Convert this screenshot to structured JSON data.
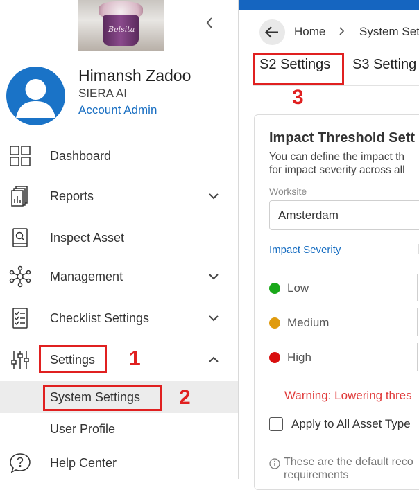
{
  "profile": {
    "name": "Himansh Zadoo",
    "organization": "SIERA AI",
    "role": "Account Admin",
    "photo_brand_text": "Belsita"
  },
  "nav": {
    "dashboard": "Dashboard",
    "reports": "Reports",
    "inspect_asset": "Inspect Asset",
    "management": "Management",
    "checklist_settings": "Checklist Settings",
    "settings": "Settings",
    "system_settings": "System Settings",
    "user_profile": "User Profile",
    "help_center": "Help Center"
  },
  "annotations": {
    "n1": "1",
    "n2": "2",
    "n3": "3"
  },
  "breadcrumb": {
    "home": "Home",
    "current": "System Set"
  },
  "tabs": {
    "s2": "S2 Settings",
    "s3": "S3 Setting"
  },
  "card": {
    "title": "Impact Threshold Sett",
    "desc_line1": "You can define the impact th",
    "desc_line2": "for impact severity across all",
    "worksite_label": "Worksite",
    "worksite_value": "Amsterdam",
    "severity_header": "Impact Severity",
    "severities": [
      {
        "name": "Low",
        "color": "#1aa81a"
      },
      {
        "name": "Medium",
        "color": "#e09b0e"
      },
      {
        "name": "High",
        "color": "#d90f0f"
      }
    ],
    "warning": "Warning: Lowering thres",
    "apply_label": "Apply to All Asset Type",
    "info_line1": "These are the default reco",
    "info_line2": "requirements"
  },
  "colors": {
    "accent": "#1565c0",
    "link": "#1a6fc2",
    "annotation": "#e02020"
  }
}
